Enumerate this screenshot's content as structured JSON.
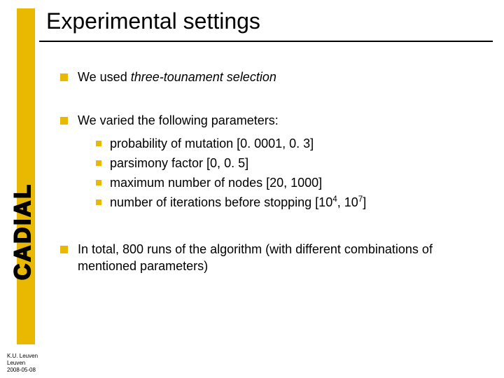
{
  "title": "Experimental settings",
  "logo": "CADIAL",
  "bullets": {
    "b1_pre": "We used ",
    "b1_italic": "three-tounament selection",
    "b2": "We varied the following parameters:",
    "b2_sub": {
      "s1": "probability of mutation [0. 0001, 0. 3]",
      "s2": "parsimony factor [0, 0. 5]",
      "s3": "maximum number of nodes [20, 1000]",
      "s4_pre": "number of iterations before stopping [10",
      "s4_sup1": "4",
      "s4_mid": ", 10",
      "s4_sup2": "7",
      "s4_post": "]"
    },
    "b3": "In total, 800 runs of the algorithm (with different combinations of mentioned parameters)"
  },
  "footer": {
    "l1": "K.U. Leuven",
    "l2": "Leuven",
    "l3": "2008-05-08"
  }
}
